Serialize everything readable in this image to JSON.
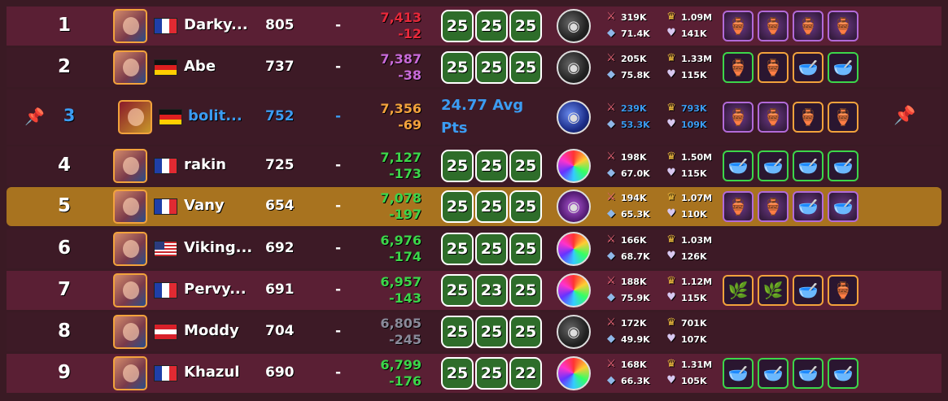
{
  "rows": [
    {
      "rank": "1",
      "name": "Darky...",
      "flag": "fr",
      "level": "805",
      "dash": "-",
      "points": "7,413",
      "delta": "-12",
      "points_color": "#e8283a",
      "delta_color": "#e8283a",
      "stats": [
        "25",
        "25",
        "25"
      ],
      "orb": "dark",
      "atk": "319K",
      "def": "71.4K",
      "ego": "1.09M",
      "harm": "141K",
      "items": [
        "purple",
        "purple",
        "purple",
        "purple"
      ],
      "item_glyphs": [
        "g",
        "g",
        "g",
        "g"
      ]
    },
    {
      "rank": "2",
      "name": "Abe",
      "flag": "de",
      "level": "737",
      "dash": "-",
      "points": "7,387",
      "delta": "-38",
      "points_color": "#c86ad8",
      "delta_color": "#c86ad8",
      "stats": [
        "25",
        "25",
        "25"
      ],
      "orb": "dark",
      "atk": "205K",
      "def": "75.8K",
      "ego": "1.33M",
      "harm": "115K",
      "items": [
        "green",
        "gold",
        "gold",
        "green"
      ],
      "item_glyphs": [
        "g",
        "g",
        "h",
        "h"
      ]
    },
    {
      "rank": "3",
      "name": "bolit...",
      "flag": "de",
      "level": "752",
      "dash": "-",
      "points": "7,356",
      "delta": "-69",
      "points_color": "#f2a23c",
      "delta_color": "#f2a23c",
      "avg": "24.77 Avg",
      "avg2": "Pts",
      "orb": "blue",
      "atk": "239K",
      "def": "53.3K",
      "ego": "793K",
      "harm": "109K",
      "items": [
        "purple",
        "purple",
        "gold",
        "gold"
      ],
      "item_glyphs": [
        "g",
        "g",
        "g",
        "g"
      ],
      "me": true
    },
    {
      "rank": "4",
      "name": "rakin",
      "flag": "fr",
      "level": "725",
      "dash": "-",
      "points": "7,127",
      "delta": "-173",
      "points_color": "#3cd64a",
      "delta_color": "#3cd64a",
      "stats": [
        "25",
        "25",
        "25"
      ],
      "orb": "rainbow",
      "atk": "198K",
      "def": "67.0K",
      "ego": "1.50M",
      "harm": "115K",
      "items": [
        "green",
        "green",
        "green",
        "green"
      ],
      "item_glyphs": [
        "h",
        "h",
        "h",
        "h"
      ]
    },
    {
      "rank": "5",
      "name": "Vany",
      "flag": "fr",
      "level": "654",
      "dash": "-",
      "points": "7,078",
      "delta": "-197",
      "points_color": "#3cd64a",
      "delta_color": "#3cd64a",
      "stats": [
        "25",
        "25",
        "25"
      ],
      "orb": "purple",
      "atk": "194K",
      "def": "65.3K",
      "ego": "1.07M",
      "harm": "110K",
      "items": [
        "purple",
        "purple",
        "purple",
        "purple"
      ],
      "item_glyphs": [
        "g",
        "g",
        "h",
        "h"
      ],
      "highlight": true
    },
    {
      "rank": "6",
      "name": "Viking...",
      "flag": "us",
      "level": "692",
      "dash": "-",
      "points": "6,976",
      "delta": "-174",
      "points_color": "#3cd64a",
      "delta_color": "#3cd64a",
      "stats": [
        "25",
        "25",
        "25"
      ],
      "orb": "rainbow",
      "atk": "166K",
      "def": "68.7K",
      "ego": "1.03M",
      "harm": "126K",
      "items": [],
      "item_glyphs": []
    },
    {
      "rank": "7",
      "name": "Pervy...",
      "flag": "fr",
      "level": "691",
      "dash": "-",
      "points": "6,957",
      "delta": "-143",
      "points_color": "#3cd64a",
      "delta_color": "#3cd64a",
      "stats": [
        "25",
        "23",
        "25"
      ],
      "orb": "rainbow",
      "atk": "188K",
      "def": "75.9K",
      "ego": "1.12M",
      "harm": "115K",
      "items": [
        "gold",
        "gold",
        "gold",
        "gold"
      ],
      "item_glyphs": [
        "w",
        "w",
        "h",
        "g"
      ]
    },
    {
      "rank": "8",
      "name": "Moddy",
      "flag": "at",
      "level": "704",
      "dash": "-",
      "points": "6,805",
      "delta": "-245",
      "points_color": "#8a8a9a",
      "delta_color": "#8a8a9a",
      "stats": [
        "25",
        "25",
        "25"
      ],
      "orb": "dark",
      "atk": "172K",
      "def": "49.9K",
      "ego": "701K",
      "harm": "107K",
      "items": [],
      "item_glyphs": []
    },
    {
      "rank": "9",
      "name": "Khazul",
      "flag": "fr",
      "level": "690",
      "dash": "-",
      "points": "6,799",
      "delta": "-176",
      "points_color": "#3cd64a",
      "delta_color": "#3cd64a",
      "stats": [
        "25",
        "25",
        "22"
      ],
      "orb": "rainbow",
      "atk": "168K",
      "def": "66.3K",
      "ego": "1.31M",
      "harm": "105K",
      "items": [
        "green",
        "green",
        "green",
        "green"
      ],
      "item_glyphs": [
        "h",
        "h",
        "h",
        "h"
      ]
    }
  ],
  "icons": {
    "pin": "pin-icon",
    "thumbtack": "thumbtack-icon"
  },
  "colors": {
    "accent_blue": "#3b9cf2",
    "highlight": "#a8731f",
    "row_odd": "#5a1f34",
    "row_even": "#3d1a26",
    "stat_green": "#2e6d2a"
  }
}
